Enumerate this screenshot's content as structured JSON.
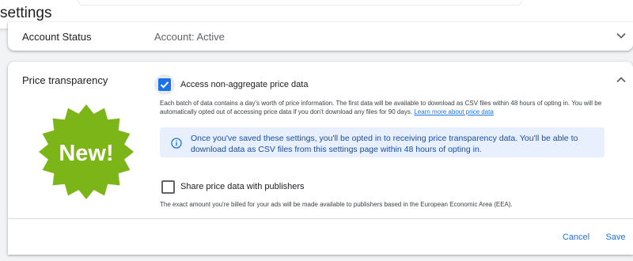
{
  "header": {
    "title": "settings"
  },
  "account_status": {
    "label": "Account Status",
    "value": "Account: Active",
    "expand_icon": "chevron-down-icon"
  },
  "price_transparency": {
    "title": "Price transparency",
    "collapse_icon": "chevron-up-icon",
    "badge_text": "New!",
    "badge_color": "#7cb518",
    "access_option": {
      "label": "Access non-aggregate price data",
      "checked": true,
      "description": "Each batch of data contains a day's worth of price information. The first data will be available to download as CSV files within 48 hours of opting in. You will be automatically opted out of accessing price data if you don't download any files for 90 days.",
      "link_text": "Learn more about price data"
    },
    "info_message": "Once you've saved these settings, you'll be opted in to receiving price transparency data. You'll be able to download data as CSV files from this settings page within 48 hours of opting in.",
    "info_icon": "info-icon",
    "share_option": {
      "label": "Share price data with publishers",
      "checked": false,
      "description": "The exact amount you're billed for your ads will be made available to publishers based in the European Economic Area (EEA)."
    },
    "actions": {
      "cancel_label": "Cancel",
      "save_label": "Save"
    }
  },
  "colors": {
    "accent": "#1a73e8",
    "info_background": "#e8f0fe",
    "info_text": "#174ea6"
  }
}
